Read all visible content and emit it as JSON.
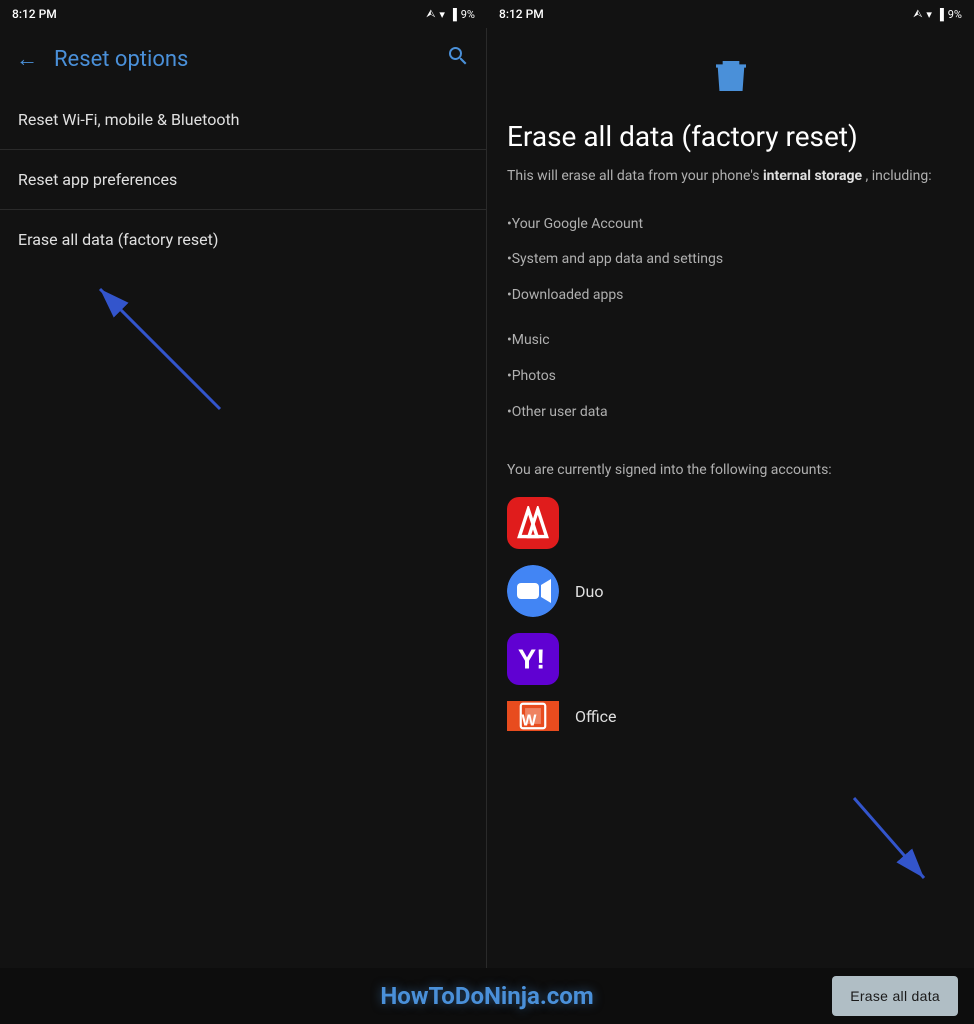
{
  "left_status": {
    "time": "8:12 PM",
    "icons": "🔒 •"
  },
  "right_status": {
    "time": "8:12 PM",
    "icons": "🔒 •"
  },
  "left_panel": {
    "title": "Reset options",
    "back_label": "←",
    "search_label": "🔍",
    "menu_items": [
      {
        "label": "Reset Wi-Fi, mobile & Bluetooth"
      },
      {
        "label": "Reset app preferences"
      },
      {
        "label": "Erase all data (factory reset)"
      }
    ]
  },
  "right_panel": {
    "title": "Erase all data (factory reset)",
    "description_start": "This will erase all data from your phone's ",
    "description_bold": "internal storage",
    "description_end": ", including:",
    "data_items": [
      "•Your Google Account",
      "•System and app data and settings",
      "•Downloaded apps",
      "•Music",
      "•Photos",
      "•Other user data"
    ],
    "accounts_intro": "You are currently signed into the following accounts:",
    "accounts": [
      {
        "name": "Adobe",
        "label": ""
      },
      {
        "name": "Duo",
        "label": "Duo"
      },
      {
        "name": "Yahoo",
        "label": ""
      },
      {
        "name": "Office",
        "label": "Office"
      }
    ]
  },
  "bottom": {
    "watermark": "HowToDoNinja.com",
    "erase_button": "Erase all data"
  }
}
